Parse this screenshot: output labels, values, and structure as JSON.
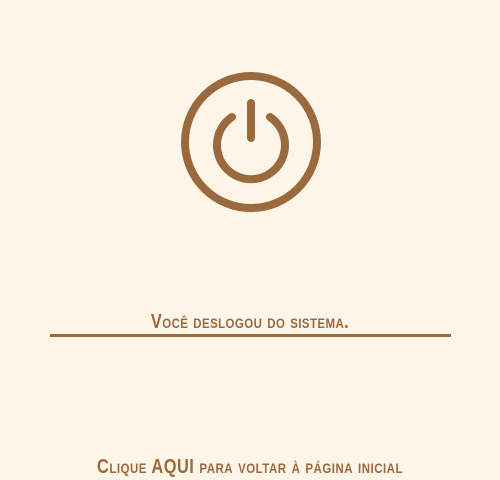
{
  "logout": {
    "icon": "power-icon",
    "message": "Você deslogou do sistema.",
    "return_prefix": "Clique ",
    "return_link": "AQUI",
    "return_suffix": " para voltar à página inicial",
    "accent_color": "#9a6a3e",
    "background_color": "#fdf5e8"
  }
}
